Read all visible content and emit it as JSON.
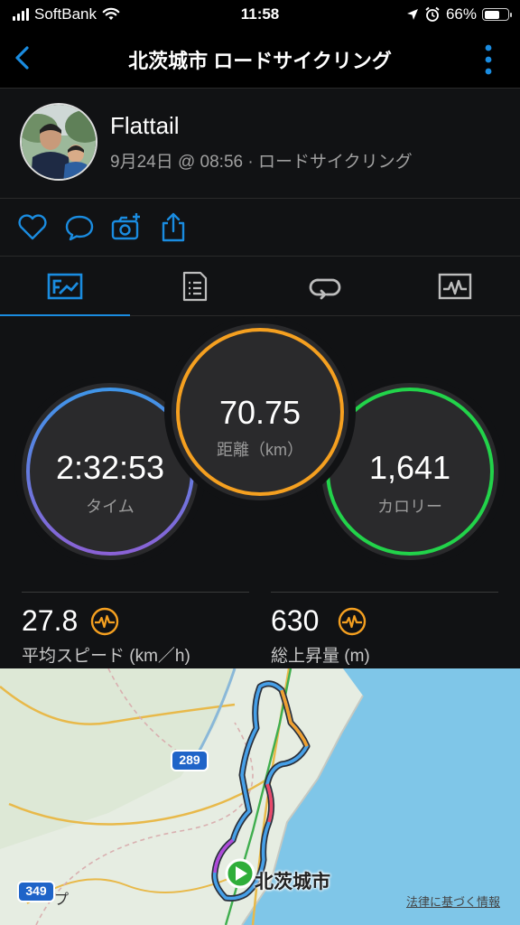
{
  "status_bar": {
    "carrier": "SoftBank",
    "time": "11:58",
    "battery_percent": "66%",
    "battery_level": 0.66
  },
  "nav": {
    "title": "北茨城市 ロードサイクリング"
  },
  "activity": {
    "user_name": "Flattail",
    "meta": "9月24日 @ 08:56 · ロードサイクリング"
  },
  "tabs": [
    "overview",
    "details",
    "laps",
    "charts"
  ],
  "summary": {
    "time": {
      "value": "2:32:53",
      "label": "タイム"
    },
    "distance": {
      "value": "70.75",
      "label": "距離（km）"
    },
    "calories": {
      "value": "1,641",
      "label": "カロリー"
    }
  },
  "metrics": {
    "avg_speed": {
      "value": "27.8",
      "label": "平均スピード (km／h)"
    },
    "elevation_gain": {
      "value": "630",
      "label": "総上昇量 (m)"
    }
  },
  "map": {
    "route_label": "289",
    "route_label_2": "349",
    "city": "北茨城市",
    "legal": "法律に基づく情報",
    "maps_suffix": "プ"
  },
  "colors": {
    "accent_blue": "#1a8ce0",
    "time_ring": "#4a8fe0",
    "distance_ring": "#f5a020",
    "calories_ring": "#22d34a",
    "metric_icon": "#f5a020",
    "sea": "#7fc6e8"
  }
}
